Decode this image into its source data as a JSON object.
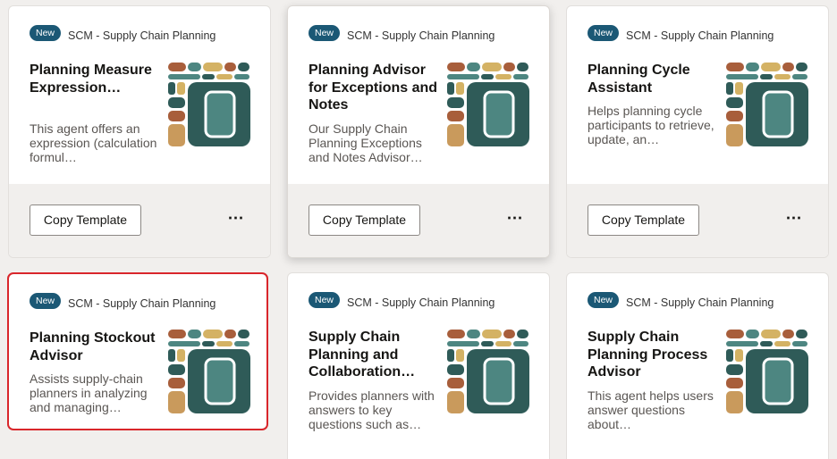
{
  "colors": {
    "badge": "#1b5875",
    "selected_outline": "#d9262b",
    "art_dark": "#2f5b58",
    "art_teal": "#4d8681",
    "art_rust": "#a85e3b",
    "art_mustard": "#d4b264",
    "art_tan": "#c99a5c"
  },
  "cards": [
    {
      "badge": "New",
      "category": "SCM - Supply Chain Planning",
      "title": "Planning Measure Expression…",
      "description": "This agent offers an expression (calculation formul…",
      "action": "Copy Template",
      "more_icon": "ellipsis-icon",
      "art_icon": "agent-mosaic-icon"
    },
    {
      "badge": "New",
      "category": "SCM - Supply Chain Planning",
      "title": "Planning Advisor for Exceptions and Notes",
      "description": "Our Supply Chain Planning Exceptions and Notes Advisor…",
      "action": "Copy Template",
      "more_icon": "ellipsis-icon",
      "art_icon": "agent-mosaic-icon"
    },
    {
      "badge": "New",
      "category": "SCM - Supply Chain Planning",
      "title": "Planning Cycle Assistant",
      "description": "Helps planning cycle participants to retrieve, update, an…",
      "action": "Copy Template",
      "more_icon": "ellipsis-icon",
      "art_icon": "agent-mosaic-icon"
    },
    {
      "badge": "New",
      "category": "SCM - Supply Chain Planning",
      "title": "Planning Stockout Advisor",
      "description": "Assists supply-chain planners in analyzing and managing…",
      "art_icon": "agent-mosaic-icon"
    },
    {
      "badge": "New",
      "category": "SCM - Supply Chain Planning",
      "title": "Supply Chain Planning and Collaboration…",
      "description": "Provides planners with answers to key questions such as…",
      "art_icon": "agent-mosaic-icon"
    },
    {
      "badge": "New",
      "category": "SCM - Supply Chain Planning",
      "title": "Supply Chain Planning Process Advisor",
      "description": "This agent helps users answer questions about…",
      "art_icon": "agent-mosaic-icon"
    }
  ]
}
